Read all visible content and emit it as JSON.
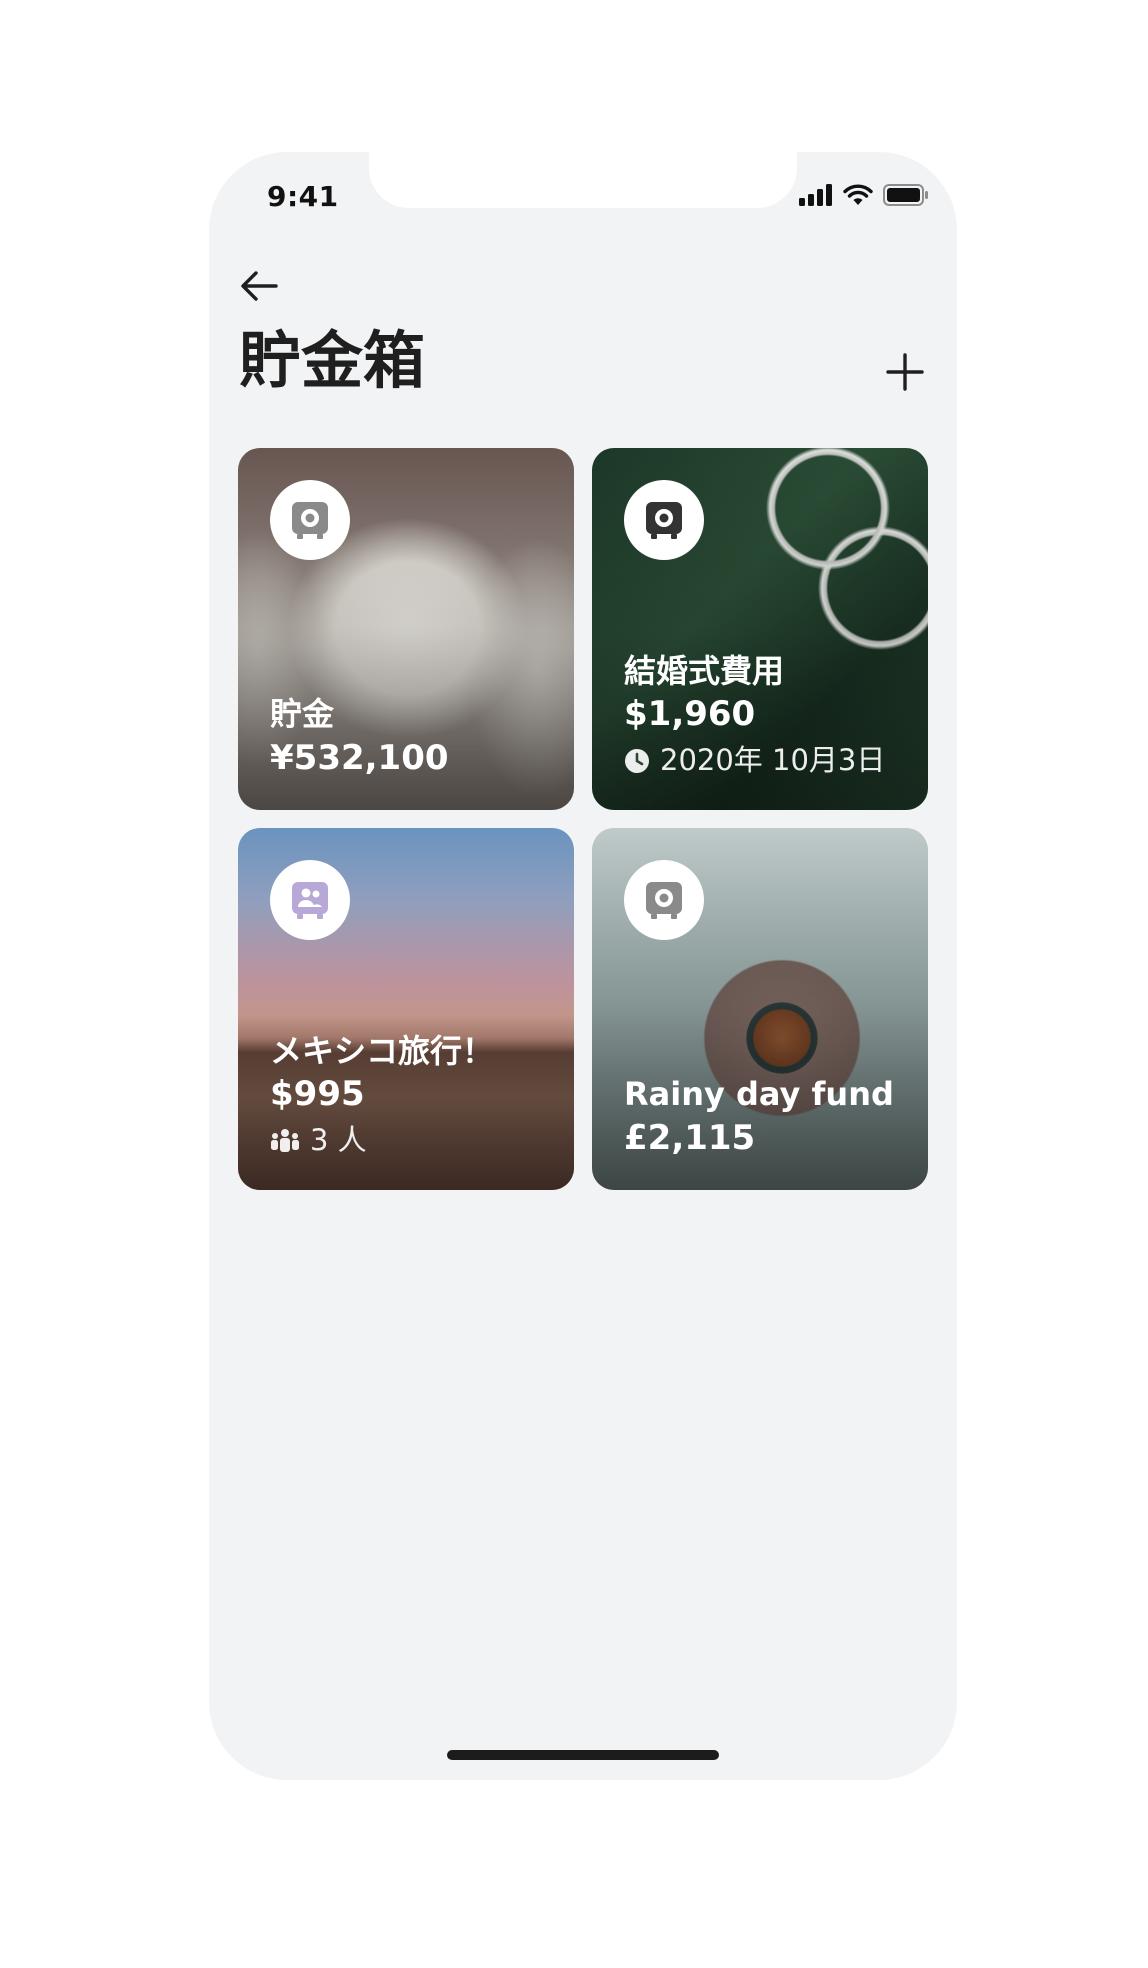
{
  "status_bar": {
    "time": "9:41"
  },
  "header": {
    "title": "貯金箱"
  },
  "cards": [
    {
      "name": "貯金",
      "amount": "¥532,100",
      "icon": "safe-icon"
    },
    {
      "name": "結婚式費用",
      "amount": "$1,960",
      "meta": "2020年 10月3日",
      "meta_icon": "clock-icon",
      "icon": "safe-icon"
    },
    {
      "name": "メキシコ旅行！",
      "amount": "$995",
      "meta": "3 人",
      "meta_icon": "people-icon",
      "icon": "shared-safe-icon",
      "icon_color": "#b8a8d8"
    },
    {
      "name": "Rainy day fund",
      "amount": "£2,115",
      "icon": "safe-icon"
    }
  ],
  "colors": {
    "background": "#f2f3f5",
    "text": "#1f1f1f",
    "icon_gray": "#8a8a8a"
  }
}
